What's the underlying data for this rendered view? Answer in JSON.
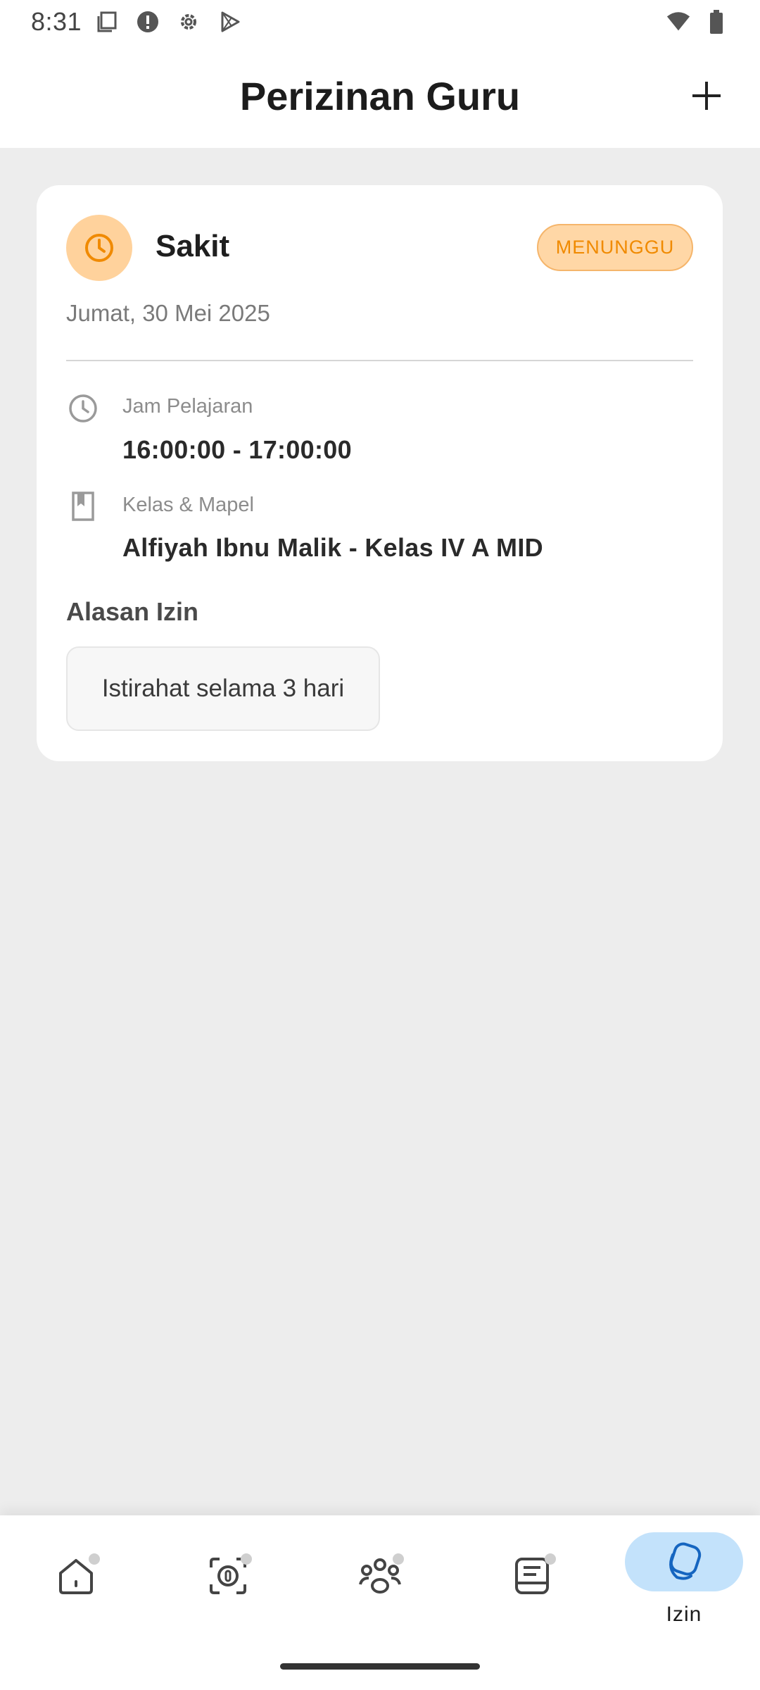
{
  "status_bar": {
    "time": "8:31",
    "left_icons": [
      "screenshot-icon",
      "alert-icon",
      "settings-icon",
      "play-store-icon"
    ],
    "right_icons": [
      "wifi-icon",
      "battery-icon"
    ]
  },
  "app_bar": {
    "title": "Perizinan Guru",
    "add_icon": "plus-icon"
  },
  "leave_card": {
    "type": "Sakit",
    "type_icon": "clock-icon",
    "status": "MENUNGGU",
    "date": "Jumat, 30 Mei 2025",
    "lesson_hours_label": "Jam Pelajaran",
    "lesson_hours_value": "16:00:00 - 17:00:00",
    "class_subject_label": "Kelas & Mapel",
    "class_subject_value": "Alfiyah Ibnu Malik - Kelas IV A MID",
    "reason_heading": "Alasan Izin",
    "reason_text": "Istirahat selama 3 hari"
  },
  "bottom_nav": {
    "items": [
      {
        "icon": "home-icon",
        "label": ""
      },
      {
        "icon": "scan-icon",
        "label": ""
      },
      {
        "icon": "people-icon",
        "label": ""
      },
      {
        "icon": "report-icon",
        "label": ""
      },
      {
        "icon": "permission-icon",
        "label": "Izin"
      }
    ],
    "active_index": 4
  },
  "colors": {
    "accent_orange": "#f08a00",
    "avatar_bg": "#ffd29c",
    "active_nav_bg": "#c3e2fb",
    "active_nav_icon": "#1565c0"
  }
}
